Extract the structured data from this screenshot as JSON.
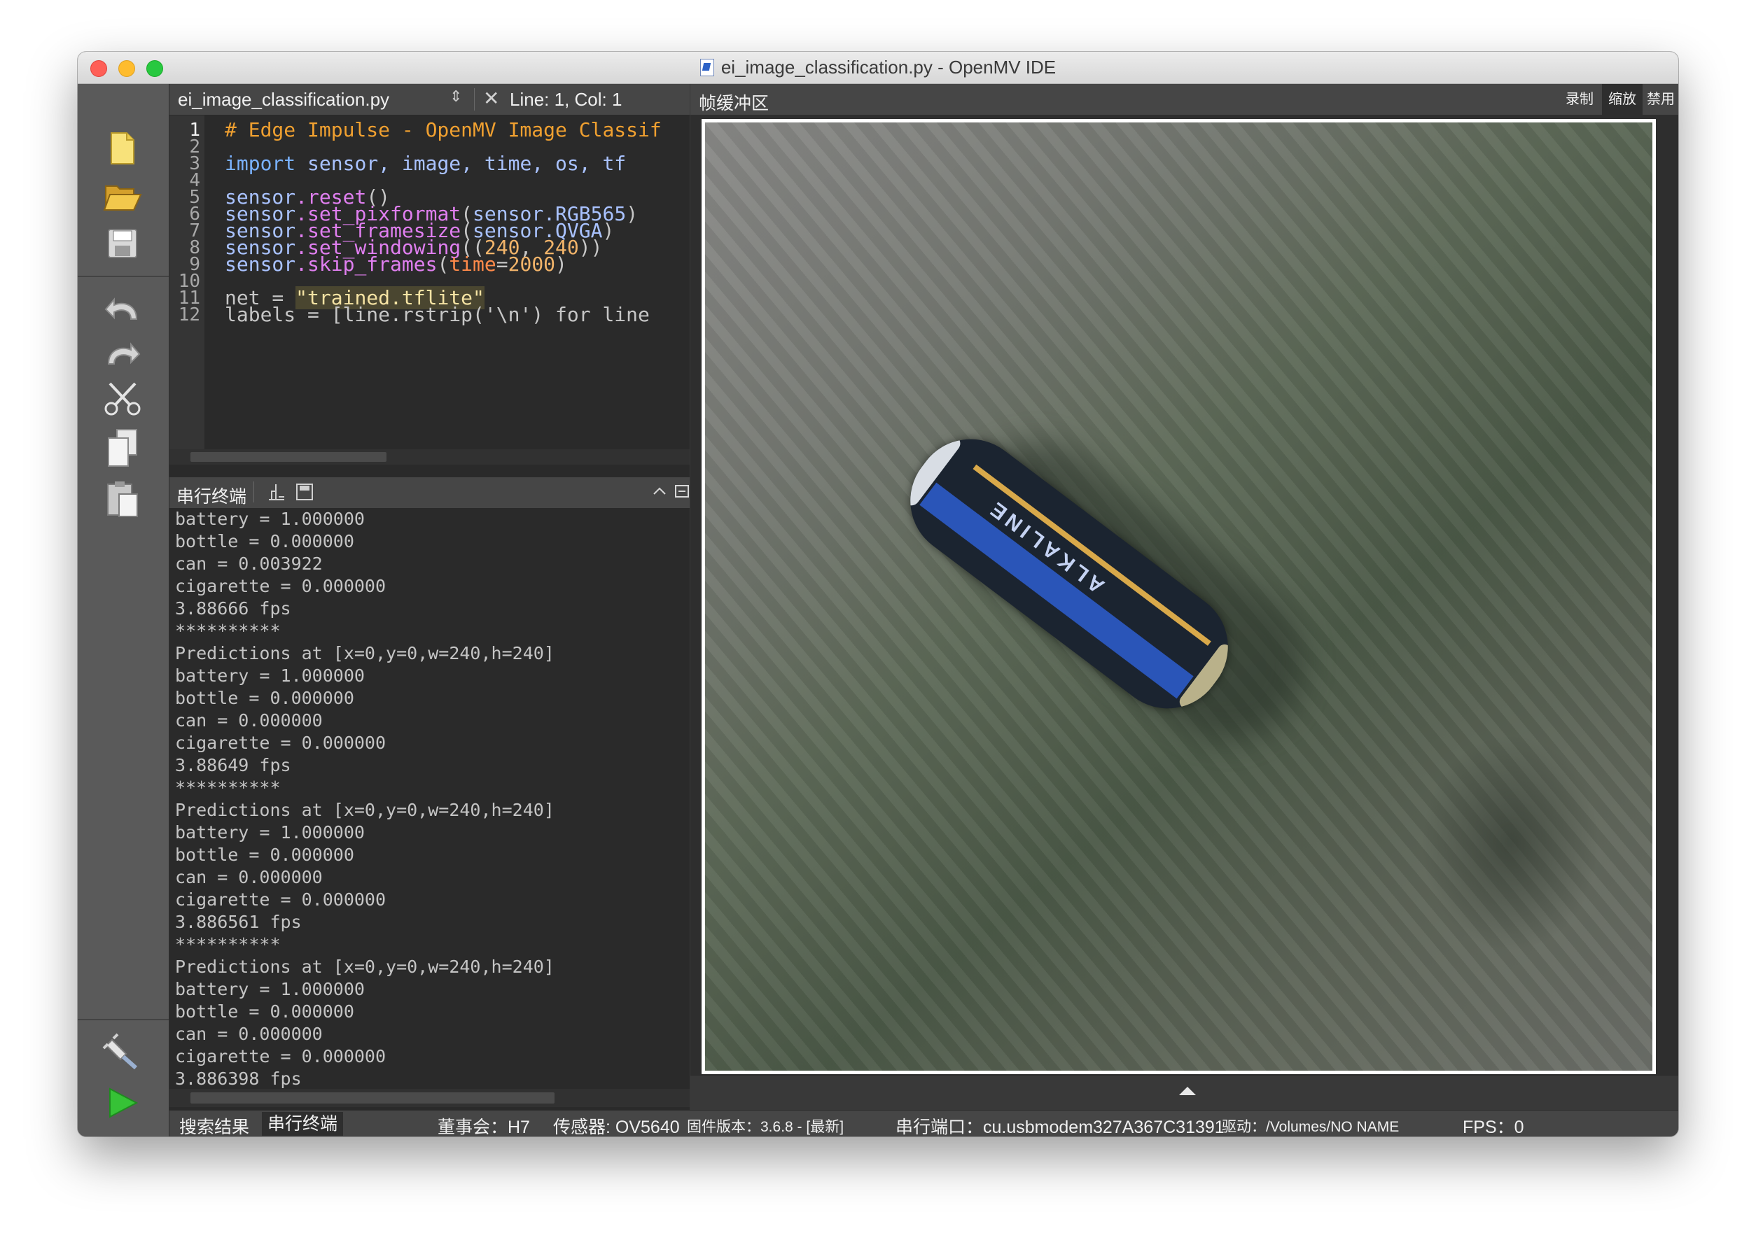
{
  "window": {
    "title": "ei_image_classification.py - OpenMV IDE"
  },
  "toolbar": {
    "buttons": [
      {
        "name": "new-file-icon"
      },
      {
        "name": "open-folder-icon"
      },
      {
        "name": "save-icon"
      },
      {
        "name": "undo-icon"
      },
      {
        "name": "redo-icon"
      },
      {
        "name": "cut-icon"
      },
      {
        "name": "copy-icon"
      },
      {
        "name": "paste-icon"
      },
      {
        "name": "connect-icon"
      },
      {
        "name": "run-icon"
      }
    ]
  },
  "editor": {
    "filename": "ei_image_classification.py",
    "updown": "⇕",
    "close": "✕",
    "line_col": "Line: 1, Col: 1",
    "line_numbers": [
      "1",
      "2",
      "3",
      "4",
      "5",
      "6",
      "7",
      "8",
      "9",
      "10",
      "11",
      "12"
    ],
    "lines": {
      "l1_comment": "# Edge Impulse - OpenMV Image Classif",
      "l3_import": "import",
      "l3_modules": "sensor, image, time, os, tf",
      "l5_obj": "sensor",
      "l5_meth": ".reset",
      "l5_rest": "()",
      "l6_obj": "sensor",
      "l6_meth": ".set_pixformat",
      "l6_p1": "(",
      "l6_arg": "sensor.RGB565",
      "l6_p2": ")",
      "l7_obj": "sensor",
      "l7_meth": ".set_framesize",
      "l7_p1": "(",
      "l7_arg": "sensor.QVGA",
      "l7_p2": ")",
      "l8_obj": "sensor",
      "l8_meth": ".set_windowing",
      "l8_p1": "((",
      "l8_n1": "240",
      "l8_c": ", ",
      "l8_n2": "240",
      "l8_p2": "))",
      "l9_obj": "sensor",
      "l9_meth": ".skip_frames",
      "l9_p1": "(",
      "l9_kw": "time",
      "l9_eq": "=",
      "l9_n": "2000",
      "l9_p2": ")",
      "l11_var": "net = ",
      "l11_str": "\"trained.tflite\"",
      "l12_partial": "labels = [line.rstrip('\\n') for line"
    }
  },
  "terminal": {
    "title": "串行终端",
    "lines": [
      "battery = 1.000000",
      "bottle = 0.000000",
      "can = 0.003922",
      "cigarette = 0.000000",
      "3.88666 fps",
      "**********",
      "Predictions at [x=0,y=0,w=240,h=240]",
      "battery = 1.000000",
      "bottle = 0.000000",
      "can = 0.000000",
      "cigarette = 0.000000",
      "3.88649 fps",
      "**********",
      "Predictions at [x=0,y=0,w=240,h=240]",
      "battery = 1.000000",
      "bottle = 0.000000",
      "can = 0.000000",
      "cigarette = 0.000000",
      "3.886561 fps",
      "**********",
      "Predictions at [x=0,y=0,w=240,h=240]",
      "battery = 1.000000",
      "bottle = 0.000000",
      "can = 0.000000",
      "cigarette = 0.000000",
      "3.886398 fps"
    ]
  },
  "framebuffer": {
    "title": "帧缓冲区",
    "record": "录制",
    "zoom": "缩放",
    "disable": "禁用",
    "image_label": "ALKALINE"
  },
  "statusbar": {
    "search_results": "搜索结果",
    "serial_terminal": "串行终端",
    "board": "董事会：H7",
    "sensor": "传感器: OV5640",
    "firmware": "固件版本：3.6.8 - [最新]",
    "serial_port": "串行端口：cu.usbmodem327A367C31391",
    "drive": "驱动：/Volumes/NO NAME",
    "fps": "FPS：0"
  }
}
